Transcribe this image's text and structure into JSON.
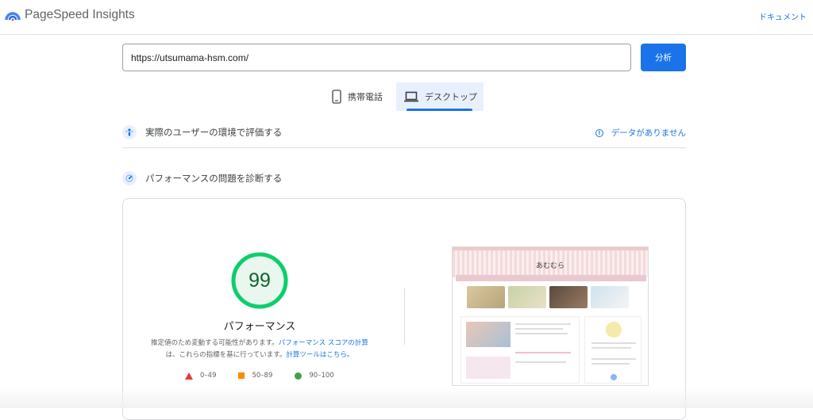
{
  "header": {
    "app_title": "PageSpeed Insights",
    "docs_label": "ドキュメント"
  },
  "url_bar": {
    "value": "https://utsumama-hsm.com/",
    "analyze_label": "分析"
  },
  "tabs": [
    {
      "label": "携帯電話",
      "icon": "phone-icon",
      "active": false
    },
    {
      "label": "デスクトップ",
      "icon": "laptop-icon",
      "active": true
    }
  ],
  "field_data": {
    "title": "実際のユーザーの環境で評価する",
    "status": "データがありません"
  },
  "lab_data": {
    "title": "パフォーマンスの問題を診断する"
  },
  "performance": {
    "score": "99",
    "score_fraction": 0.99,
    "label": "パフォーマンス",
    "desc_1": "推定値のため変動する可能性があります。",
    "desc_link_1": "パフォーマンス スコアの計算",
    "desc_2": "は、これらの指標を基に行っています。",
    "desc_link_2": "計算ツールはこちら。"
  },
  "legend": [
    {
      "range": "0–49",
      "color": "#e53935"
    },
    {
      "range": "50–89",
      "color": "#fb8c00"
    },
    {
      "range": "90–100",
      "color": "#43a047"
    }
  ],
  "thumbnail": {
    "site_title": "あむむら"
  },
  "colors": {
    "accent": "#1a73e8",
    "good": "#0cce6b"
  }
}
